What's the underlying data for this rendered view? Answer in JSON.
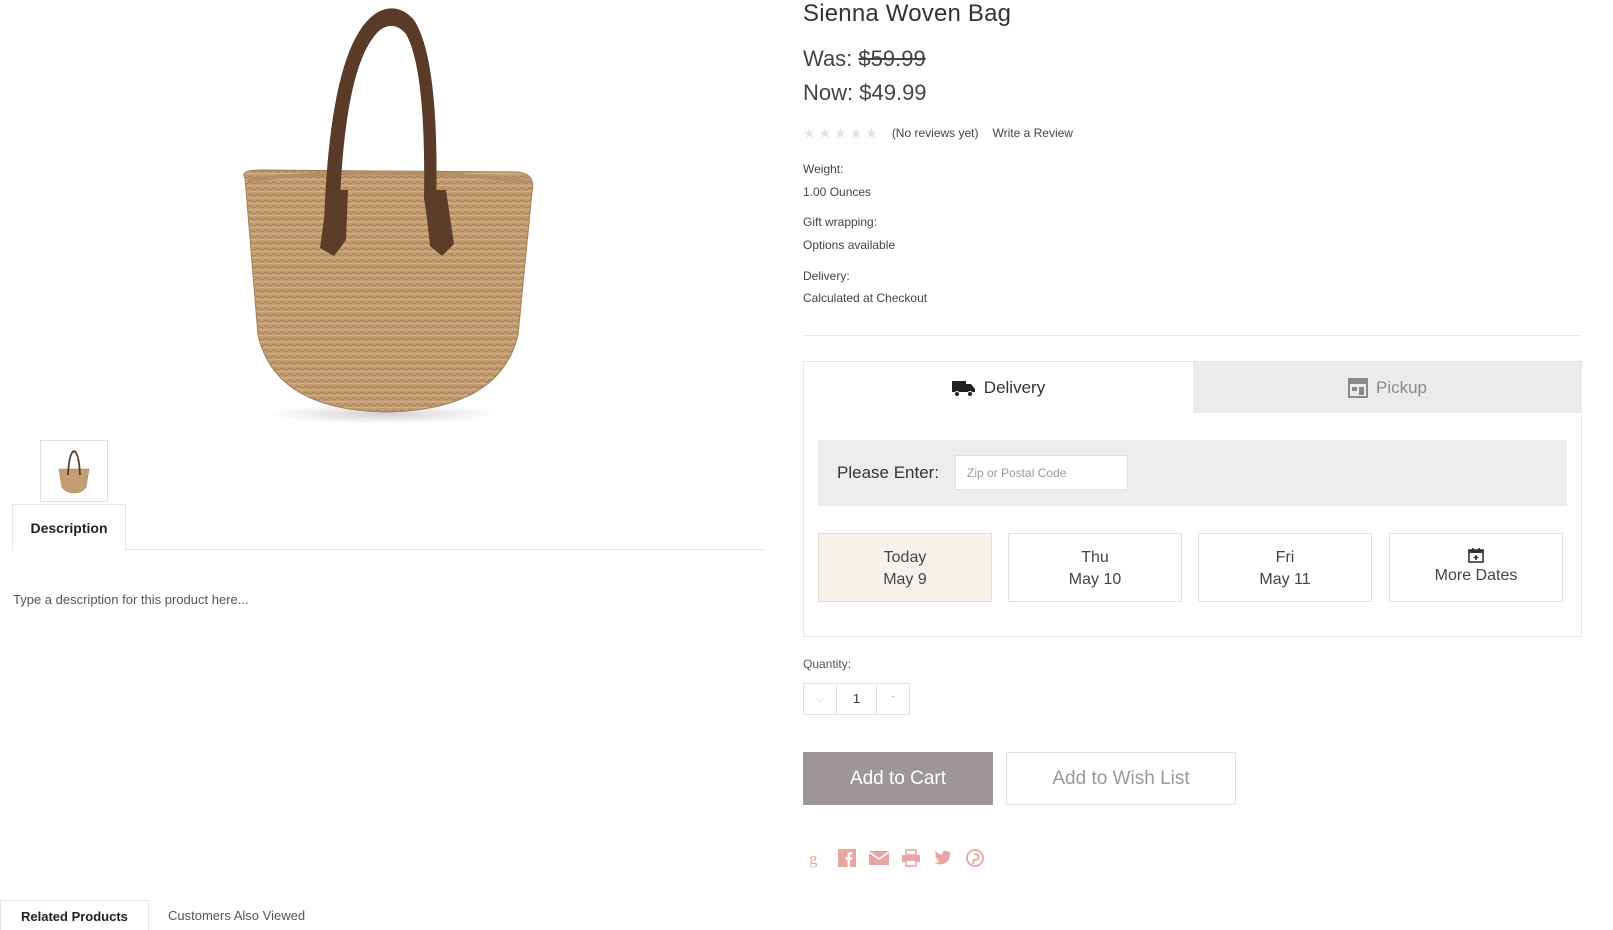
{
  "product": {
    "title": "Sienna Woven Bag",
    "was_label": "Was:",
    "was_price": "$59.99",
    "now_label": "Now:",
    "now_price": "$49.99",
    "rating": {
      "stars": 0,
      "max": 5,
      "status": "(No reviews yet)",
      "review_link": "Write a Review"
    },
    "specs": [
      {
        "label": "Weight:",
        "value": "1.00 Ounces"
      },
      {
        "label": "Gift wrapping:",
        "value": "Options available"
      },
      {
        "label": "Delivery:",
        "value": "Calculated at Checkout"
      }
    ]
  },
  "description": {
    "tab_label": "Description",
    "text": "Type a description for this product here..."
  },
  "fulfillment": {
    "tabs": [
      {
        "label": "Delivery",
        "icon": "truck-icon",
        "active": true
      },
      {
        "label": "Pickup",
        "icon": "store-icon",
        "active": false
      }
    ],
    "zip_label": "Please Enter:",
    "zip_placeholder": "Zip or Postal Code",
    "dates": [
      {
        "line1": "Today",
        "line2": "May 9",
        "selected": true
      },
      {
        "line1": "Thu",
        "line2": "May 10",
        "selected": false
      },
      {
        "line1": "Fri",
        "line2": "May 11",
        "selected": false
      },
      {
        "line1": "More Dates",
        "icon": "calendar-icon",
        "selected": false
      }
    ]
  },
  "quantity": {
    "label": "Quantity:",
    "value": "1"
  },
  "actions": {
    "add_to_cart": "Add to Cart",
    "add_to_wishlist": "Add to Wish List"
  },
  "share_icons": [
    "google-plus-icon",
    "facebook-icon",
    "email-icon",
    "print-icon",
    "twitter-icon",
    "pinterest-icon"
  ],
  "bottom_tabs": [
    {
      "label": "Related Products",
      "active": true
    },
    {
      "label": "Customers Also Viewed",
      "active": false
    }
  ],
  "colors": {
    "accent_icon": "#e9a5a0",
    "primary_button": "#9e9696",
    "selected_date_bg": "#f7f3ec",
    "inactive_tab_bg": "#ebebeb"
  }
}
